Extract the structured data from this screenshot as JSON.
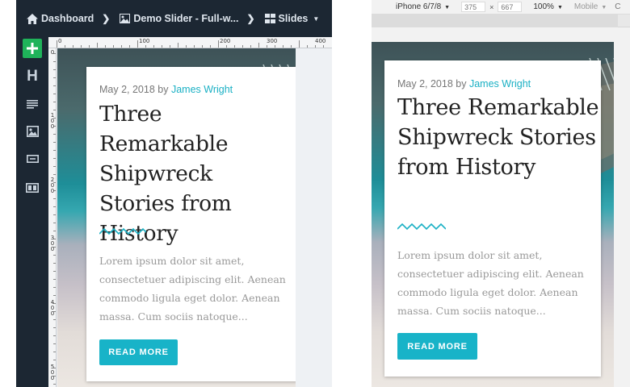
{
  "editor": {
    "breadcrumb": [
      {
        "label": "Dashboard",
        "icon": "home-icon"
      },
      {
        "label": "Demo Slider - Full-w...",
        "icon": "image-icon"
      },
      {
        "label": "Slides",
        "icon": "grid-icon"
      }
    ],
    "sidebar_tools": [
      "add-layer-icon",
      "heading-icon",
      "text-icon",
      "image-icon",
      "button-icon",
      "row-icon"
    ],
    "heading_tool_glyph": "H",
    "ruler_top_labels": [
      "0",
      "100",
      "200",
      "300",
      "400"
    ],
    "ruler_left_labels": [
      "0",
      "100",
      "200",
      "300",
      "400",
      "500"
    ]
  },
  "preview": {
    "device": "iPhone 6/7/8",
    "width": "375",
    "height": "667",
    "dimension_separator": "×",
    "zoom": "100%",
    "mode": "Mobile",
    "more": "C"
  },
  "slide": {
    "date": "May 2, 2018",
    "by": "by",
    "author": "James Wright",
    "title": "Three Remarkable Shipwreck Stories from History",
    "excerpt": "Lorem ipsum dolor sit amet, consectetuer adipiscing elit. Aenean commodo ligula eget dolor. Aenean massa. Cum sociis natoque...",
    "button_label": "READ MORE",
    "accent_color": "#1ab0c4"
  },
  "colors": {
    "editor_dark": "#1c2733",
    "add_green": "#1fb35a",
    "button_teal": "#18b3c8"
  }
}
